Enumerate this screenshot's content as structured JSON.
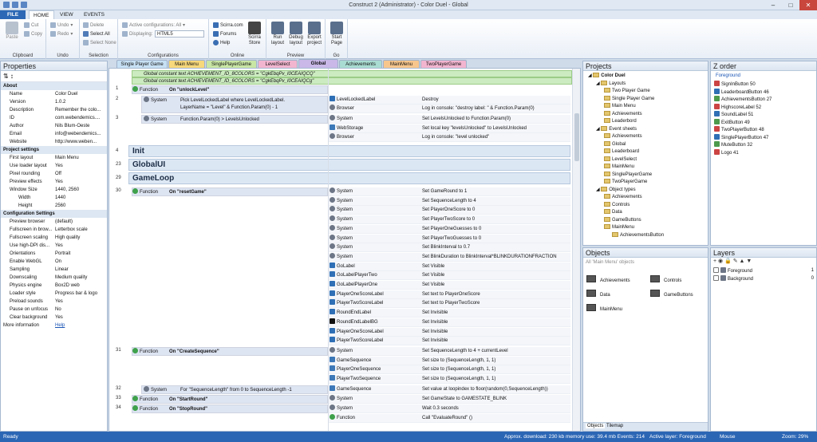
{
  "title": "Construct 2 (Administrator) - Color Duel - Global",
  "menu_tabs": [
    "FILE",
    "HOME",
    "VIEW",
    "EVENTS"
  ],
  "ribbon": {
    "clipboard": {
      "label": "Clipboard",
      "paste": "Paste",
      "cut": "Cut",
      "copy": "Copy"
    },
    "undo": {
      "label": "Undo",
      "undo": "Undo",
      "redo": "Redo"
    },
    "selection": {
      "label": "Selection",
      "delete": "Delete",
      "select_all": "Select All",
      "select_none": "Select None"
    },
    "configs": {
      "label": "Configurations",
      "active": "Active configurations: All",
      "displaying_label": "Displaying:",
      "displaying_value": "HTML5"
    },
    "online": {
      "label": "Online",
      "scirra_com": "Scirra.com",
      "forums": "Forums",
      "help": "Help",
      "store": "Scirra Store"
    },
    "preview": {
      "label": "Preview",
      "run": "Run layout",
      "debug": "Debug layout",
      "export": "Export project"
    },
    "go": {
      "label": "Go",
      "start": "Start Page"
    }
  },
  "properties": {
    "title": "Properties",
    "rows": [
      {
        "h": "About"
      },
      {
        "k": "Name",
        "v": "Color Duel"
      },
      {
        "k": "Version",
        "v": "1.0.2"
      },
      {
        "k": "Description",
        "v": "Remember the colo..."
      },
      {
        "k": "ID",
        "v": "com.webendemics...."
      },
      {
        "k": "Author",
        "v": "Nils Blum-Oeste"
      },
      {
        "k": "Email",
        "v": "info@webendemics..."
      },
      {
        "k": "Website",
        "v": "http://www.weben..."
      },
      {
        "h": "Project settings"
      },
      {
        "k": "First layout",
        "v": "Main Menu"
      },
      {
        "k": "Use loader layout",
        "v": "Yes"
      },
      {
        "k": "Pixel rounding",
        "v": "Off"
      },
      {
        "k": "Preview effects",
        "v": "Yes"
      },
      {
        "k": "Window Size",
        "v": "1440, 2560"
      },
      {
        "k": "Width",
        "v": "1440",
        "i": 1
      },
      {
        "k": "Height",
        "v": "2560",
        "i": 1
      },
      {
        "h": "Configuration Settings"
      },
      {
        "k": "Preview browser",
        "v": "(default)"
      },
      {
        "k": "Fullscreen in brow...",
        "v": "Letterbox scale"
      },
      {
        "k": "Fullscreen scaling",
        "v": "High quality"
      },
      {
        "k": "Use high-DPI dis...",
        "v": "Yes"
      },
      {
        "k": "Orientations",
        "v": "Portrait"
      },
      {
        "k": "Enable WebGL",
        "v": "On"
      },
      {
        "k": "Sampling",
        "v": "Linear"
      },
      {
        "k": "Downscaling",
        "v": "Medium quality"
      },
      {
        "k": "Physics engine",
        "v": "Box2D web"
      },
      {
        "k": "Loader style",
        "v": "Progress bar & logo"
      },
      {
        "k": "Preload sounds",
        "v": "Yes"
      },
      {
        "k": "Pause on unfocus",
        "v": "No"
      },
      {
        "k": "Clear background",
        "v": "Yes"
      },
      {
        "k": "More information",
        "v": "Help",
        "link": 1
      }
    ]
  },
  "doc_tabs": [
    {
      "label": "Single Player Game",
      "color": "#c7e0f4"
    },
    {
      "label": "Main Menu",
      "color": "#f7d87a"
    },
    {
      "label": "SinglePlayerGame",
      "color": "#c9e6a4"
    },
    {
      "label": "LevelSelect",
      "color": "#f2b5cf"
    },
    {
      "label": "Global",
      "color": "#c9b8e8",
      "active": true
    },
    {
      "label": "Achievements",
      "color": "#a9dcd2"
    },
    {
      "label": "MainMenu",
      "color": "#f7c68d"
    },
    {
      "label": "TwoPlayerGame",
      "color": "#f2b5cf"
    }
  ],
  "events": {
    "constants": [
      "Global constant text  ACHIEVEMENT_ID_8COLORS = \"CgkEbqPv_I0CEAIQCQ\"",
      "Global constant text  ACHIEVEMENT_ID_6COLORS = \"CgkEbqPv_I0CEAIQCg\""
    ],
    "rows": [
      {
        "n": "1",
        "kind": "Function",
        "text": "On \"unlockLevel\""
      },
      {
        "n": "2",
        "obj": "System",
        "cond": "Pick  LevelLockedLabel where LevelLockedLabel.",
        "cond2": "LayerName = \"Level\" & Function.Param(0) - 1"
      },
      {
        "n": "3",
        "obj": "System",
        "cond": "Function.Param(0) > LevelsUnlocked"
      },
      {
        "n": "4",
        "group": "Init"
      },
      {
        "n": "23",
        "group": "GlobalUI"
      },
      {
        "n": "29",
        "group": "GameLoop"
      },
      {
        "n": "30",
        "kind": "Function",
        "text": "On \"resetGame\""
      },
      {
        "n": "31",
        "kind": "Function",
        "text": "On \"CreateSequence\""
      },
      {
        "n": "32",
        "obj": "System",
        "cond": "For \"SequenceLength\" from 0 to SequenceLength -1"
      },
      {
        "n": "33",
        "kind": "Function",
        "text": "On \"StartRound\""
      },
      {
        "n": "34",
        "kind": "Function",
        "text": "On \"StopRound\""
      }
    ],
    "actions": [
      {
        "o": "LevelLockedLabel",
        "a": "Destroy",
        "ic": "t"
      },
      {
        "o": "Browser",
        "a": "Log in console: \"destroy label: \" & Function.Param(0)",
        "ic": "web"
      },
      {
        "o": "System",
        "a": "Set LevelsUnlocked to Function.Param(0)",
        "ic": "gear"
      },
      {
        "o": "WebStorage",
        "a": "Set local key \"levelsUnlocked\" to LevelsUnlocked",
        "ic": "grid"
      },
      {
        "o": "Browser",
        "a": "Log in console: \"level unlocked\"",
        "ic": "web"
      },
      {
        "o": "System",
        "a": "Set GameRound to 1",
        "ic": "gear"
      },
      {
        "o": "System",
        "a": "Set SequenceLength to 4",
        "ic": "gear"
      },
      {
        "o": "System",
        "a": "Set PlayerOneScore to 0",
        "ic": "gear"
      },
      {
        "o": "System",
        "a": "Set PlayerTwoScore to 0",
        "ic": "gear"
      },
      {
        "o": "System",
        "a": "Set PlayerOneGuesses to 0",
        "ic": "gear"
      },
      {
        "o": "System",
        "a": "Set PlayerTwoGuesses to 0",
        "ic": "gear"
      },
      {
        "o": "System",
        "a": "Set BlinkInterval to 0.7",
        "ic": "gear"
      },
      {
        "o": "System",
        "a": "Set BlinkDuration to BlinkInterval*BLINKDURATIONFRACTION",
        "ic": "gear"
      },
      {
        "o": "GoLabel",
        "a": "Set Visible",
        "ic": "t"
      },
      {
        "o": "GoLabelPlayerTwo",
        "a": "Set Visible",
        "ic": "t"
      },
      {
        "o": "GoLabelPlayerOne",
        "a": "Set Visible",
        "ic": "t"
      },
      {
        "o": "PlayerOneScoreLabel",
        "a": "Set text to PlayerOneScore",
        "ic": "t"
      },
      {
        "o": "PlayerTwoScoreLabel",
        "a": "Set text to PlayerTwoScore",
        "ic": "t"
      },
      {
        "o": "RoundEndLabel",
        "a": "Set Invisible",
        "ic": "t"
      },
      {
        "o": "RoundEndLabelBG",
        "a": "Set Invisible",
        "ic": "b"
      },
      {
        "o": "PlayerOneScoreLabel",
        "a": "Set Invisible",
        "ic": "t"
      },
      {
        "o": "PlayerTwoScoreLabel",
        "a": "Set Invisible",
        "ic": "t"
      },
      {
        "o": "System",
        "a": "Set SequenceLength to 4 + currentLevel",
        "ic": "gear"
      },
      {
        "o": "GameSequence",
        "a": "Set size to (SequenceLength, 1, 1)",
        "ic": "grid"
      },
      {
        "o": "PlayerOneSequence",
        "a": "Set size to (SequenceLength, 1, 1)",
        "ic": "grid"
      },
      {
        "o": "PlayerTwoSequence",
        "a": "Set size to (SequenceLength, 1, 1)",
        "ic": "grid"
      },
      {
        "o": "GameSequence",
        "a": "Set value at loopindex to floor(random(0,SequenceLength))",
        "ic": "grid"
      },
      {
        "o": "System",
        "a": "Set GameState to GAMESTATE_BLINK",
        "ic": "gear"
      },
      {
        "o": "System",
        "a": "Wait 0.3 seconds",
        "ic": "gear"
      },
      {
        "o": "Function",
        "a": "Call \"EvaluateRound\" ()",
        "ic": "f"
      }
    ]
  },
  "projects": {
    "title": "Projects",
    "items": [
      {
        "t": "Color Duel",
        "d": 0,
        "b": 1
      },
      {
        "t": "Layouts",
        "d": 1
      },
      {
        "t": "Two Player Game",
        "d": 2
      },
      {
        "t": "Single Player Game",
        "d": 2
      },
      {
        "t": "Main Menu",
        "d": 2
      },
      {
        "t": "Achievements",
        "d": 2
      },
      {
        "t": "Leaderbord",
        "d": 2
      },
      {
        "t": "Event sheets",
        "d": 1
      },
      {
        "t": "Achievements",
        "d": 2
      },
      {
        "t": "Global",
        "d": 2
      },
      {
        "t": "Leaderboard",
        "d": 2
      },
      {
        "t": "LevelSelect",
        "d": 2
      },
      {
        "t": "MainMenu",
        "d": 2
      },
      {
        "t": "SinglePlayerGame",
        "d": 2
      },
      {
        "t": "TwoPlayerGame",
        "d": 2
      },
      {
        "t": "Object types",
        "d": 1
      },
      {
        "t": "Achievements",
        "d": 2
      },
      {
        "t": "Controls",
        "d": 2
      },
      {
        "t": "Data",
        "d": 2
      },
      {
        "t": "GameButtons",
        "d": 2
      },
      {
        "t": "MainMenu",
        "d": 2
      },
      {
        "t": "AchievementsButton",
        "d": 3
      }
    ]
  },
  "zorder": {
    "title": "Z order",
    "layer": "Foreground",
    "items": [
      "SignInButton 50",
      "LeaderboardButton 46",
      "AchievementsButton 27",
      "HighscoreLabel 52",
      "SoundLabel 51",
      "ExitButton 49",
      "TwoPlayerButton 48",
      "SinglePlayerButton 47",
      "MuteButton 32",
      "Logo 41"
    ]
  },
  "objects": {
    "title": "Objects",
    "filter": "All 'Main Menu' objects",
    "folders": [
      "Achievements",
      "Controls",
      "Data",
      "GameButtons",
      "MainMenu"
    ],
    "tabs": [
      "Objects",
      "Tilemap"
    ]
  },
  "layers": {
    "title": "Layers",
    "items": [
      {
        "name": "Foreground",
        "n": "1"
      },
      {
        "name": "Background",
        "n": "0"
      }
    ]
  },
  "status": {
    "ready": "Ready",
    "info": "Approx. download: 230 kb  memory use: 39.4 mb  Events: 214",
    "active_layer": "Active layer: Foreground",
    "mouse": "Mouse",
    "zoom": "Zoom: 29%"
  },
  "colors": {
    "accent": "#2c68b5",
    "group_bg": "#dce7f4",
    "constant_bg": "#ccebc0"
  }
}
